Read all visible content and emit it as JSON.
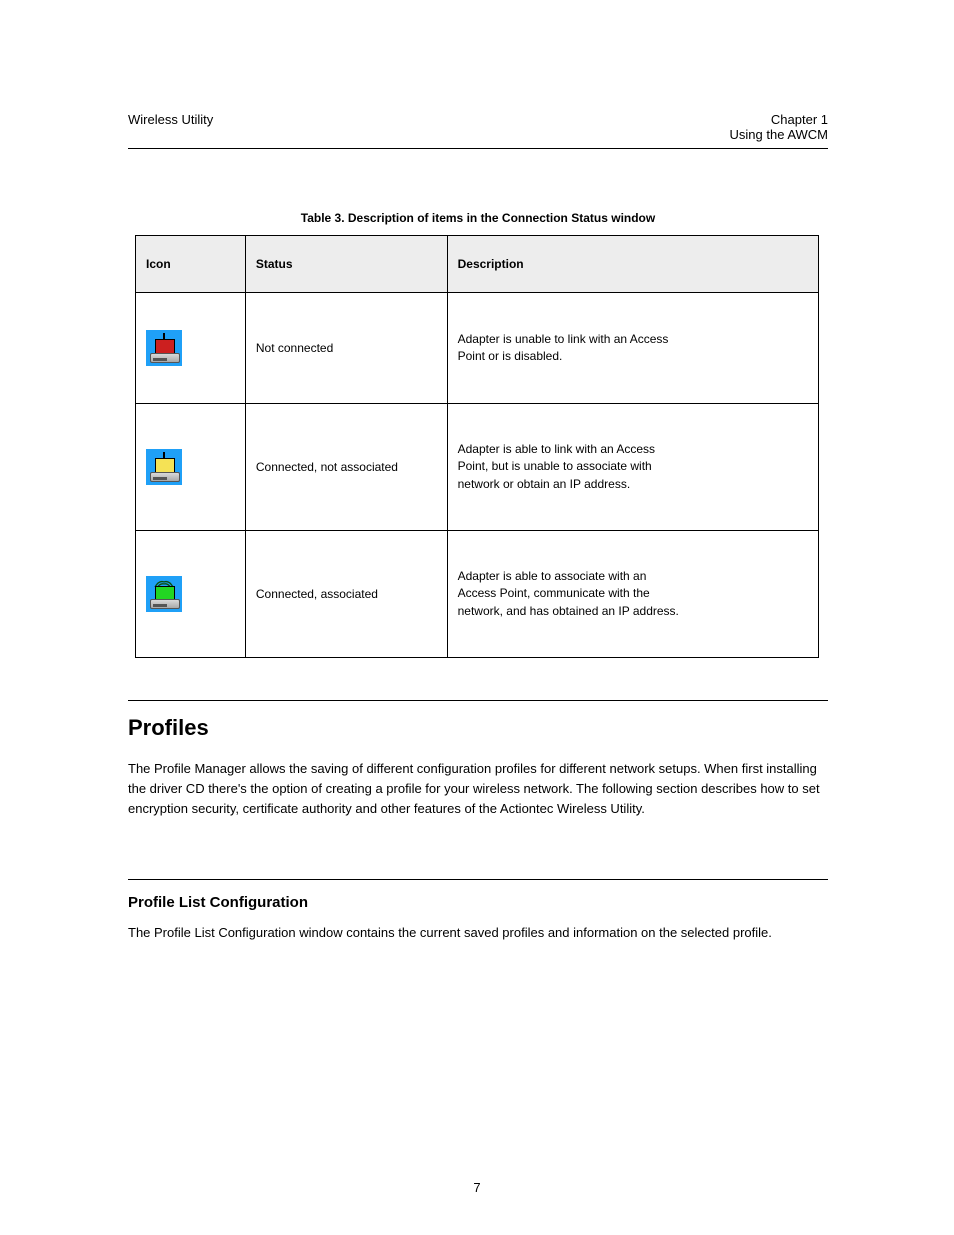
{
  "header": {
    "left_line": "Wireless Utility",
    "right_line1": "Chapter 1",
    "right_line2": "Using the AWCM"
  },
  "table": {
    "caption": "Table 3. Description of items in the Connection Status window",
    "headers": [
      "Icon",
      "Status",
      "Description"
    ],
    "rows": [
      {
        "icon": "red",
        "status": "Not connected",
        "description_lines": [
          "Adapter is unable to link with an Access",
          "Point or is disabled."
        ]
      },
      {
        "icon": "yellow",
        "status": "Connected, not associated",
        "description_lines": [
          "Adapter is able to link with an Access",
          "Point, but is unable to associate with",
          "network or obtain an IP address."
        ]
      },
      {
        "icon": "green",
        "status": "Connected, associated",
        "description_lines": [
          "Adapter is able to associate with an",
          "Access Point, communicate with the",
          "network, and has obtained an IP address."
        ]
      }
    ]
  },
  "section1": {
    "heading": "Profiles",
    "paragraph": "The Profile Manager allows the saving of different configuration profiles for different network setups. When first installing the driver CD there's the option of creating a profile for your wireless network. The following section describes how to set encryption security, certificate authority and other features of the Actiontec Wireless Utility."
  },
  "section2": {
    "heading": "Profile List Configuration",
    "paragraph": "The Profile List Configuration window contains the current saved profiles and information on the selected profile."
  },
  "footer": {
    "page_number": "7"
  }
}
